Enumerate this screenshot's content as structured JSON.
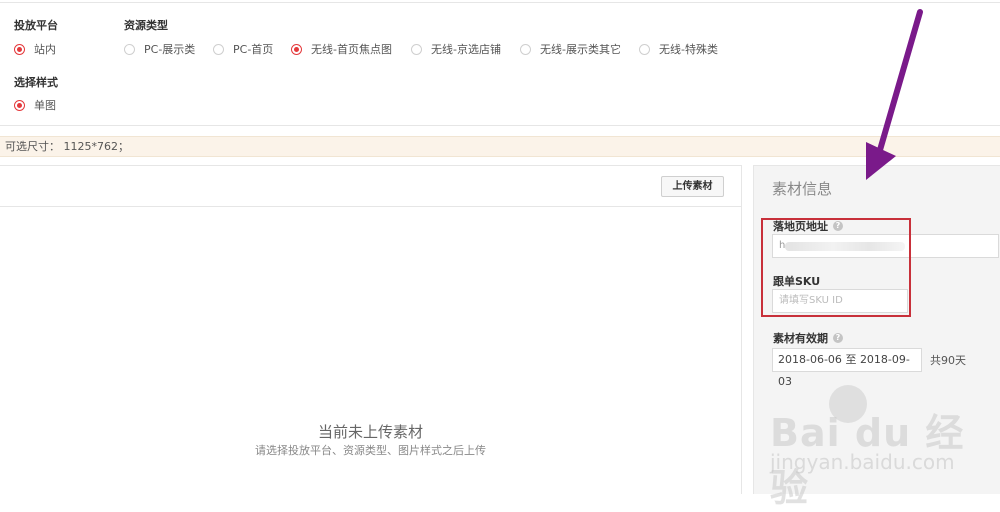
{
  "platform": {
    "label": "投放平台",
    "options": [
      {
        "label": "站内",
        "checked": true
      }
    ]
  },
  "resource_type": {
    "label": "资源类型",
    "options": [
      {
        "label": "PC-展示类",
        "checked": false
      },
      {
        "label": "PC-首页",
        "checked": false
      },
      {
        "label": "无线-首页焦点图",
        "checked": true
      },
      {
        "label": "无线-京选店铺",
        "checked": false
      },
      {
        "label": "无线-展示类其它",
        "checked": false
      },
      {
        "label": "无线-特殊类",
        "checked": false
      }
    ]
  },
  "style": {
    "label": "选择样式",
    "options": [
      {
        "label": "单图",
        "checked": true
      }
    ]
  },
  "size_bar": {
    "text": "可选尺寸： 1125*762；"
  },
  "left": {
    "upload_button": "上传素材",
    "empty_title": "当前未上传素材",
    "empty_subtitle": "请选择投放平台、资源类型、图片样式之后上传"
  },
  "right": {
    "title": "素材信息",
    "landing_label": "落地页地址",
    "landing_value_prefix": "h",
    "sku_label": "跟单SKU",
    "sku_placeholder": "请填写SKU ID",
    "validity_label": "素材有效期",
    "date_start": "2018-06-06",
    "date_sep": "至",
    "date_end": "2018-09-03",
    "days": "共90天"
  },
  "watermark": {
    "logo": "Bai  du 经验",
    "url": "jingyan.baidu.com"
  },
  "colors": {
    "accent": "#e4393c",
    "highlight_box": "#c8303a",
    "arrow": "#7a1a8a"
  },
  "icons": {
    "help": "question-circle-icon",
    "radio": "radio-icon",
    "arrow": "arrow-annotation-icon"
  }
}
